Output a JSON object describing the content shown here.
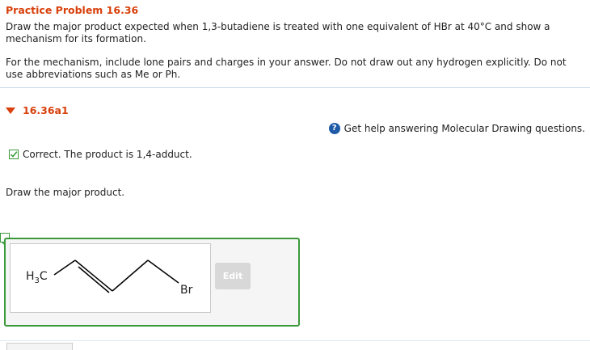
{
  "problem": {
    "title": "Practice Problem 16.36",
    "text1_line1": "Draw the major product expected when 1,3-butadiene is treated with one equivalent of HBr at 40°C and show a",
    "text1_line2": "mechanism for its formation.",
    "text2_line1": "For the mechanism, include lone pairs and charges in your answer. Do not draw out any hydrogen explicitly. Do not",
    "text2_line2": "use abbreviations such as Me or Ph."
  },
  "part": {
    "label": "16.36a1",
    "help_text": "Get help answering Molecular Drawing questions.",
    "feedback": "Correct. The product is 1,4-adduct.",
    "prompt": "Draw the major product."
  },
  "molecule": {
    "methyl_label": "H",
    "methyl_subscript": "3",
    "methyl_suffix": "C",
    "bromine_label": "Br"
  },
  "edit_button": "Edit",
  "colors": {
    "accent": "#d8400c",
    "correct": "#3a9a3a",
    "help": "#1e5aa8"
  }
}
